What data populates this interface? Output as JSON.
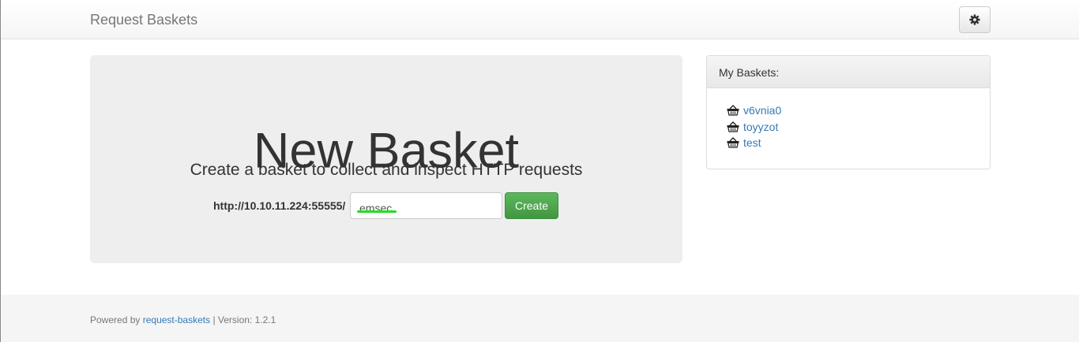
{
  "navbar": {
    "brand": "Request Baskets",
    "settings_icon": "gear-icon"
  },
  "hero": {
    "title": "New Basket",
    "subtitle": "Create a basket to collect and inspect HTTP requests",
    "url_prefix": "http://10.10.11.224:55555/",
    "basket_name_value": "emsec",
    "create_label": "Create",
    "colors": {
      "create_button": "#5cb85c",
      "underline": "#22dd22"
    }
  },
  "my_baskets": {
    "heading": "My Baskets:",
    "item_icon": "basket-icon",
    "items": [
      {
        "name": "v6vnia0"
      },
      {
        "name": "toyyzot"
      },
      {
        "name": "test"
      }
    ],
    "colors": {
      "link": "#337ab7"
    }
  },
  "footer": {
    "powered_by": "Powered by",
    "project_link": "request-baskets",
    "version": "| Version: 1.2.1"
  }
}
